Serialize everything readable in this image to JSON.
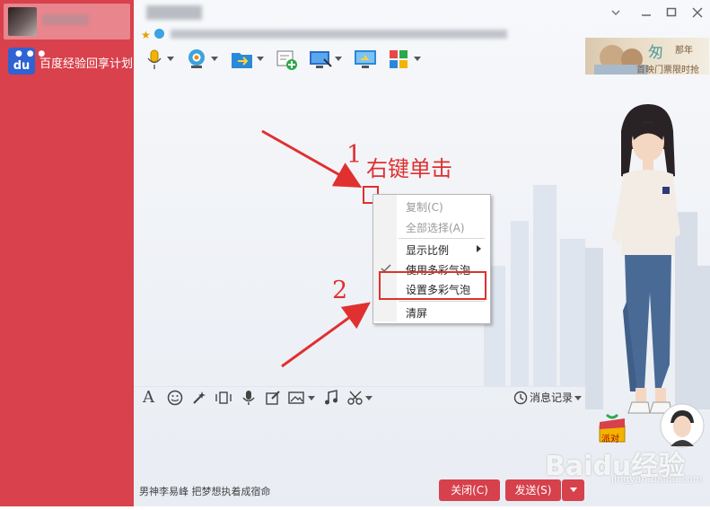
{
  "contacts": [
    {
      "label": ""
    },
    {
      "label": "百度经验回享计划"
    }
  ],
  "baidu_logo_text": "du",
  "ad": {
    "big": "匆",
    "small": "那年",
    "line": "首映门票限时抢"
  },
  "toolbar_icons": [
    "mic-icon",
    "camera-icon",
    "file-transfer-icon",
    "add-app-icon",
    "screen-share-icon",
    "remote-desktop-icon",
    "apps-grid-icon"
  ],
  "annotations": {
    "step1_num": "1",
    "step1_text": "右键单击",
    "step2_num": "2"
  },
  "context_menu": [
    {
      "label": "复制(C)",
      "disabled": true
    },
    {
      "label": "全部选择(A)",
      "disabled": true
    },
    {
      "label": "显示比例",
      "disabled": false,
      "submenu": true
    },
    {
      "label": "使用多彩气泡",
      "disabled": false,
      "checked": true
    },
    {
      "label": "设置多彩气泡",
      "disabled": false
    },
    {
      "label": "清屏",
      "disabled": false
    }
  ],
  "bottom_toolbar_icons": [
    "font-icon",
    "emoji-icon",
    "magic-icon",
    "shake-icon",
    "voice-icon",
    "edit-icon",
    "image-icon",
    "music-icon",
    "scissors-icon"
  ],
  "history_label": "消息记录",
  "footer_signature": "男神李易峰 把梦想执着成宿命",
  "buttons": {
    "close": "关闭(C)",
    "send": "发送(S)"
  },
  "watermark": {
    "main": "Baidu经验",
    "url": "jingyan.baidu.com"
  },
  "gift_label": "派对",
  "colors": {
    "sidebar": "#d9414c",
    "accent": "#e03030",
    "button": "#d6414c"
  }
}
